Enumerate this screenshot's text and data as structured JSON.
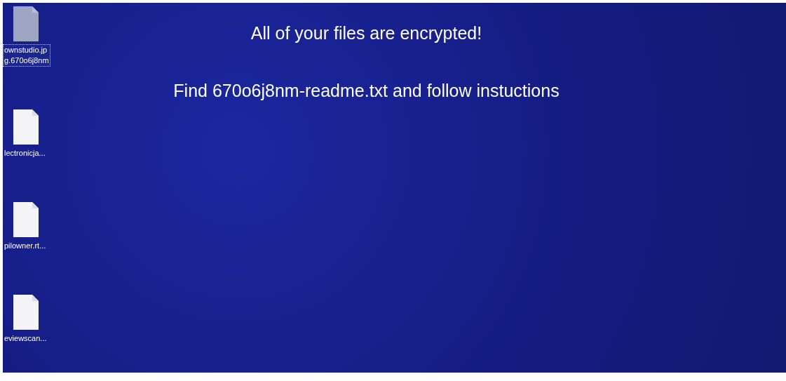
{
  "desktop_icons": [
    {
      "label_lines": [
        "ownstudio.jp",
        "g.670o6j8nm"
      ],
      "selected": true
    },
    {
      "label_lines": [
        "lectronicja..."
      ],
      "selected": false
    },
    {
      "label_lines": [
        "pilowner.rt..."
      ],
      "selected": false
    },
    {
      "label_lines": [
        "eviewscan..."
      ],
      "selected": false
    }
  ],
  "messages": [
    "All of your files are encrypted!",
    "Find 670o6j8nm-readme.txt and follow instuctions"
  ]
}
